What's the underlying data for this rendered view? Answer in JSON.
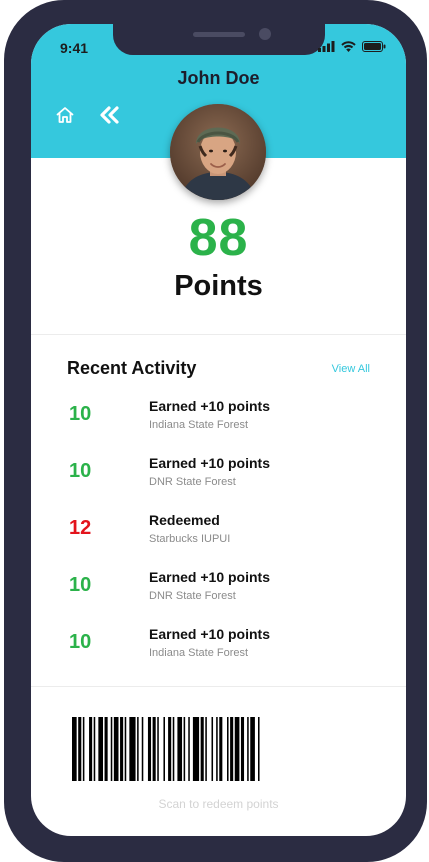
{
  "status_bar": {
    "time": "9:41"
  },
  "header": {
    "title": "John Doe"
  },
  "points": {
    "value": "88",
    "label": "Points"
  },
  "activity": {
    "title": "Recent Activity",
    "view_all": "View All",
    "items": [
      {
        "amount": "10",
        "heading": "Earned +10 points",
        "location": "Indiana State Forest",
        "color": "#2bb24a"
      },
      {
        "amount": "10",
        "heading": "Earned +10 points",
        "location": "DNR State Forest",
        "color": "#2bb24a"
      },
      {
        "amount": "12",
        "heading": "Redeemed",
        "location": "Starbucks IUPUI",
        "color": "#e3131c"
      },
      {
        "amount": "10",
        "heading": "Earned +10 points",
        "location": "DNR State Forest",
        "color": "#2bb24a"
      },
      {
        "amount": "10",
        "heading": "Earned +10 points",
        "location": "Indiana State Forest",
        "color": "#2bb24a"
      }
    ]
  },
  "barcode": {
    "caption": "Scan to redeem points"
  },
  "icons": {
    "home": "home-icon",
    "back": "double-chevron-left-icon",
    "signal": "signal-icon",
    "wifi": "wifi-icon",
    "battery": "battery-icon"
  },
  "colors": {
    "accent": "#35c8dd",
    "earn": "#2bb24a",
    "redeem": "#e3131c",
    "frame": "#2b2c42"
  }
}
